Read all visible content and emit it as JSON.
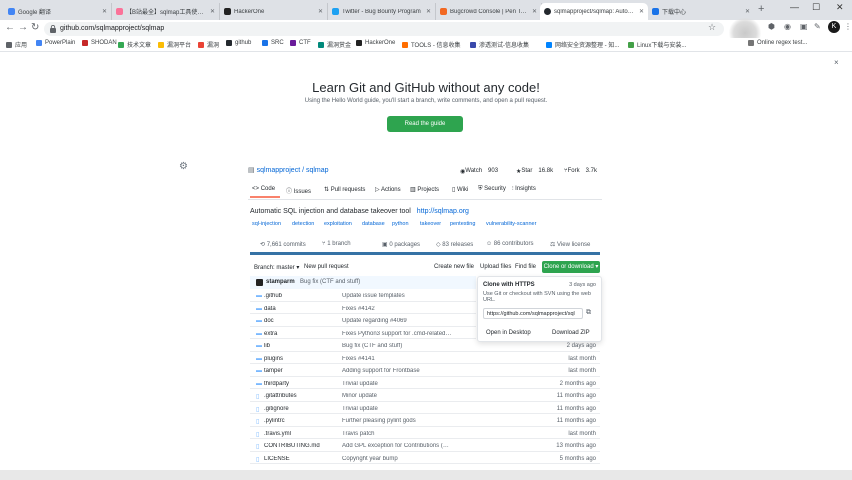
{
  "browser": {
    "tabs": [
      {
        "label": "Google 翻译",
        "color": "#4285f4"
      },
      {
        "label": "【B站最全】sqlmap工具使用教程",
        "color": "#fb7299"
      },
      {
        "label": "HackerOne",
        "color": "#222222"
      },
      {
        "label": "Twitter - Bug Bounty Program",
        "color": "#1da1f2"
      },
      {
        "label": "Bugcrowd Console | Pen Testing",
        "color": "#f26822"
      },
      {
        "label": "sqlmapproject/sqlmap: Automatic",
        "color": "#24292e"
      },
      {
        "label": "下载中心",
        "color": "#1a73e8"
      }
    ],
    "new_tab": "+",
    "address": "github.com/sqlmapproject/sqlmap",
    "profile_initial": "K",
    "window_controls": [
      "—",
      "☐",
      "✕"
    ]
  },
  "bookmarks": [
    {
      "label": "应用",
      "color": "#5f6368"
    },
    {
      "label": "PowerPlain",
      "color": "#4285f4"
    },
    {
      "label": "SHODAN",
      "color": "#c62828"
    },
    {
      "label": "技术文章",
      "color": "#34a853"
    },
    {
      "label": "漏洞平台",
      "color": "#fbbc05"
    },
    {
      "label": "漏洞",
      "color": "#ea4335"
    },
    {
      "label": "github",
      "color": "#24292e"
    },
    {
      "label": "SRC",
      "color": "#1a73e8"
    },
    {
      "label": "CTF",
      "color": "#6a1b9a"
    },
    {
      "label": "漏洞赏金",
      "color": "#00897b"
    },
    {
      "label": "HackerOne",
      "color": "#222222"
    },
    {
      "label": "TOOLS - 信息收集",
      "color": "#ff6d00"
    },
    {
      "label": "渗透测试-信息收集",
      "color": "#3949ab"
    },
    {
      "label": "网络安全资源整理 - 知...",
      "color": "#0084ff"
    },
    {
      "label": "Linux下载与安装...",
      "color": "#43a047"
    },
    {
      "label": "Online regex test...",
      "color": "#757575"
    }
  ],
  "banner": {
    "title": "Learn Git and GitHub without any code!",
    "subtitle": "Using the Hello World guide, you'll start a branch, write comments, and open a pull request.",
    "button": "Read the guide",
    "close": "×"
  },
  "repo": {
    "path": "sqlmapproject / sqlmap",
    "watch_label": "Watch",
    "watch_count": "903",
    "star_label": "Star",
    "star_count": "16.8k",
    "fork_label": "Fork",
    "fork_count": "3.7k",
    "tabs": [
      "Code",
      "Issues",
      "Pull requests",
      "Actions",
      "Projects",
      "Wiki",
      "Security",
      "Insights"
    ],
    "about": "Automatic SQL injection and database takeover tool",
    "website": "http://sqlmap.org",
    "topics": [
      "sql-injection",
      "detection",
      "exploitation",
      "database",
      "python",
      "takeover",
      "pentesting",
      "vulnerability-scanner"
    ],
    "summary": {
      "commits": "7,661 commits",
      "branches": "1 branch",
      "packages": "0 packages",
      "releases": "83 releases",
      "contributors": "86 contributors",
      "license": "View license"
    },
    "lang_color": "#3572a5",
    "branch_label": "Branch: master",
    "new_pr": "New pull request",
    "create_file": "Create new file",
    "upload": "Upload files",
    "find_file": "Find file",
    "clone_button": "Clone or download",
    "latest_commit": {
      "author": "stamparm",
      "message": "Bug fix (CTF and stuff)"
    },
    "files": [
      {
        "icon": "folder",
        "name": ".github",
        "message": "Update issue templates",
        "age": ""
      },
      {
        "icon": "folder",
        "name": "data",
        "message": "Fixes #4142",
        "age": ""
      },
      {
        "icon": "folder",
        "name": "doc",
        "message": "Update regarding #4069",
        "age": ""
      },
      {
        "icon": "folder",
        "name": "extra",
        "message": "Fixes Python3 support for .cmd-related cli...",
        "age": ""
      },
      {
        "icon": "folder",
        "name": "lib",
        "message": "Bug fix (CTF and stuff)",
        "age": "2 days ago"
      },
      {
        "icon": "folder",
        "name": "plugins",
        "message": "Fixes #4141",
        "age": "last month"
      },
      {
        "icon": "folder",
        "name": "tamper",
        "message": "Adding support for Frontbase",
        "age": "last month"
      },
      {
        "icon": "folder",
        "name": "thirdparty",
        "message": "Trivial update",
        "age": "2 months ago"
      },
      {
        "icon": "file",
        "name": ".gitattributes",
        "message": "Minor update",
        "age": "11 months ago"
      },
      {
        "icon": "file",
        "name": ".gitignore",
        "message": "Trivial update",
        "age": "11 months ago"
      },
      {
        "icon": "file",
        "name": ".pylintrc",
        "message": "Further pleasing pylint gods",
        "age": "11 months ago"
      },
      {
        "icon": "file",
        "name": ".travis.yml",
        "message": "Travis patch",
        "age": "last month"
      },
      {
        "icon": "file",
        "name": "CONTRIBUTING.md",
        "message": "Add GPL exception for Contributions (#3487)",
        "age": "13 months ago"
      },
      {
        "icon": "file",
        "name": "LICENSE",
        "message": "Copyright year bump",
        "age": "5 months ago"
      }
    ],
    "clone": {
      "title": "Clone with HTTPS",
      "help": "Use Git or checkout with SVN using the web URL.",
      "url": "https://github.com/sqlmapproject/sql",
      "open_desktop": "Open in Desktop",
      "download_zip": "Download ZIP",
      "last_commit_age": "3 days ago"
    }
  }
}
